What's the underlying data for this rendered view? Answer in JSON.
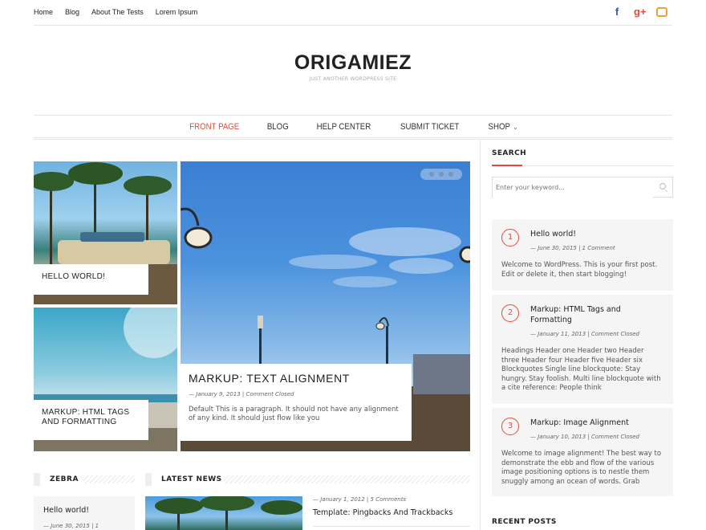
{
  "topbar": {
    "nav": [
      "Home",
      "Blog",
      "About The Tests",
      "Lorem Ipsum"
    ],
    "social": [
      {
        "icon": "facebook-icon",
        "glyph": "f"
      },
      {
        "icon": "google-plus-icon",
        "glyph": "g+"
      },
      {
        "icon": "instagram-icon",
        "glyph": ""
      }
    ]
  },
  "brand": {
    "title": "ORIGAMIEZ",
    "tagline": "JUST ANOTHER WORDPRESS SITE"
  },
  "mainnav": {
    "items": [
      "FRONT PAGE",
      "BLOG",
      "HELP CENTER",
      "SUBMIT TICKET",
      "SHOP"
    ],
    "active": "FRONT PAGE"
  },
  "featured": {
    "tile1": {
      "title": "HELLO WORLD!"
    },
    "tile2": {
      "title": "MARKUP: HTML TAGS AND FORMATTING"
    },
    "main": {
      "title": "MARKUP: TEXT ALIGNMENT",
      "meta": "— January 9, 2013 | Comment Closed",
      "excerpt": "Default This is a paragraph. It should not have any alignment of any kind. It should just flow like you"
    }
  },
  "sidebar": {
    "search_title": "SEARCH",
    "search_placeholder": "Enter your keyword...",
    "posts": [
      {
        "num": "1",
        "title": "Hello world!",
        "meta": "— June 30, 2015 | 1 Comment",
        "excerpt": "Welcome to WordPress. This is your first post. Edit or delete it, then start blogging!"
      },
      {
        "num": "2",
        "title": "Markup: HTML Tags and Formatting",
        "meta": "— January 11, 2013 | Comment Closed",
        "excerpt": "Headings Header one Header two Header three Header four Header five Header six Blockquotes Single line blockquote: Stay hungry. Stay foolish. Multi line blockquote with a cite reference: People think"
      },
      {
        "num": "3",
        "title": "Markup: Image Alignment",
        "meta": "— January 10, 2013 | Comment Closed",
        "excerpt": "Welcome to image alignment! The best way to demonstrate the ebb and flow of the various image positioning options is to nestle them snuggly among an ocean of words. Grab"
      }
    ],
    "recent_title": "RECENT POSTS"
  },
  "zebra": {
    "label": "ZEBRA",
    "post": {
      "title": "Hello world!",
      "meta": "— June 30, 2015 | 1"
    }
  },
  "latest": {
    "label": "LATEST NEWS",
    "post": {
      "meta": "— January 1, 2012 | 5 Comments",
      "title": "Template: Pingbacks And Trackbacks"
    }
  }
}
